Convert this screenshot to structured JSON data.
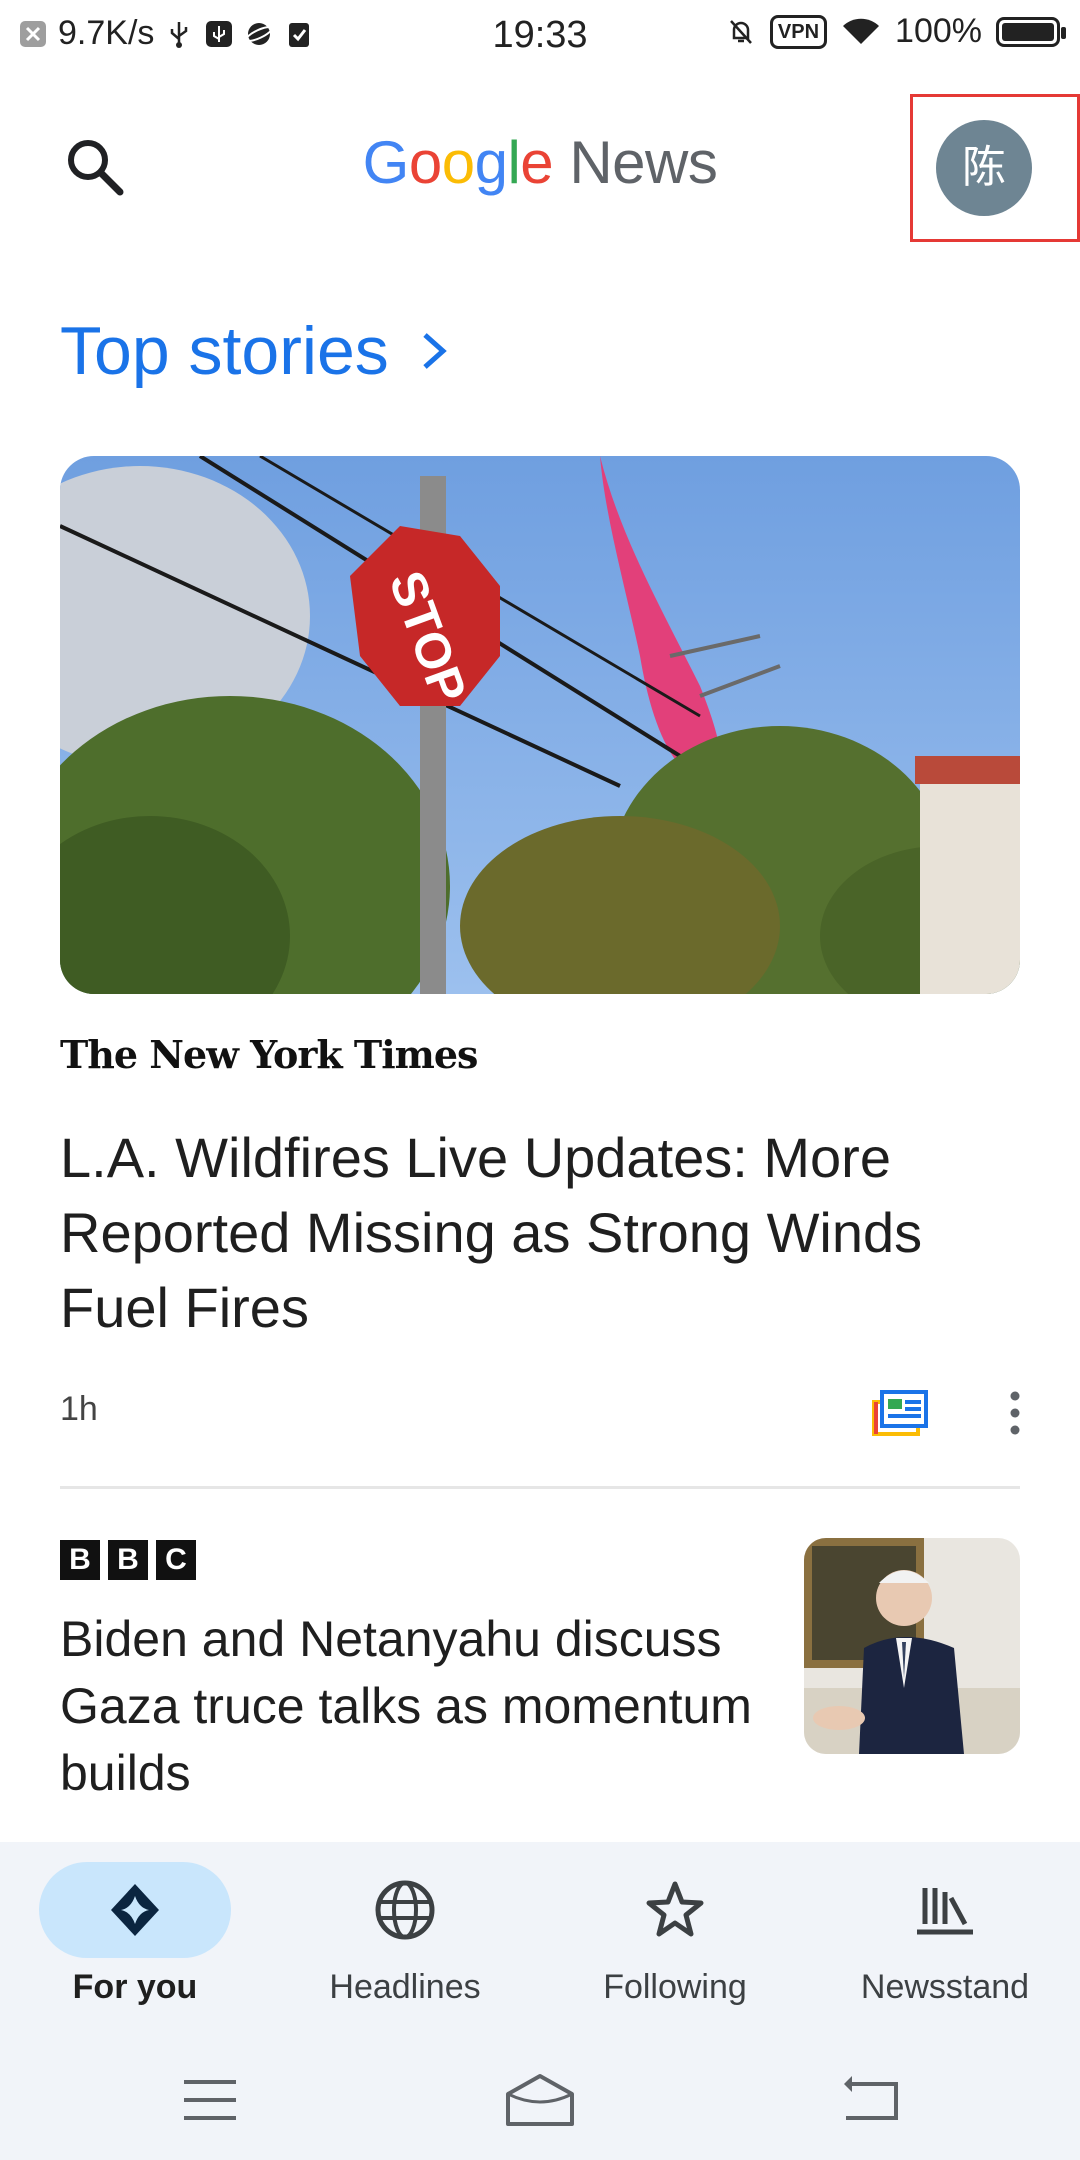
{
  "status_bar": {
    "net_speed": "9.7K/s",
    "time": "19:33",
    "vpn": "VPN",
    "battery": "100%"
  },
  "header": {
    "logo_google": [
      "G",
      "o",
      "o",
      "g",
      "l",
      "e"
    ],
    "logo_news": "News",
    "avatar_initial": "陈"
  },
  "top_stories": {
    "title": "Top stories",
    "stories": [
      {
        "source": "The New York Times",
        "headline": "L.A. Wildfires Live Updates: More Reported Missing as Strong Winds Fuel Fires",
        "time": "1h"
      },
      {
        "source": "BBC",
        "source_letters": [
          "B",
          "B",
          "C"
        ],
        "headline": "Biden and Netanyahu discuss Gaza truce talks as momentum builds"
      }
    ]
  },
  "bottom_nav": {
    "items": [
      {
        "label": "For you",
        "active": true
      },
      {
        "label": "Headlines",
        "active": false
      },
      {
        "label": "Following",
        "active": false
      },
      {
        "label": "Newsstand",
        "active": false
      }
    ]
  },
  "colors": {
    "accent": "#1a73e8",
    "active_pill": "#c9e6fc",
    "nav_bg": "#f1f4f9"
  }
}
